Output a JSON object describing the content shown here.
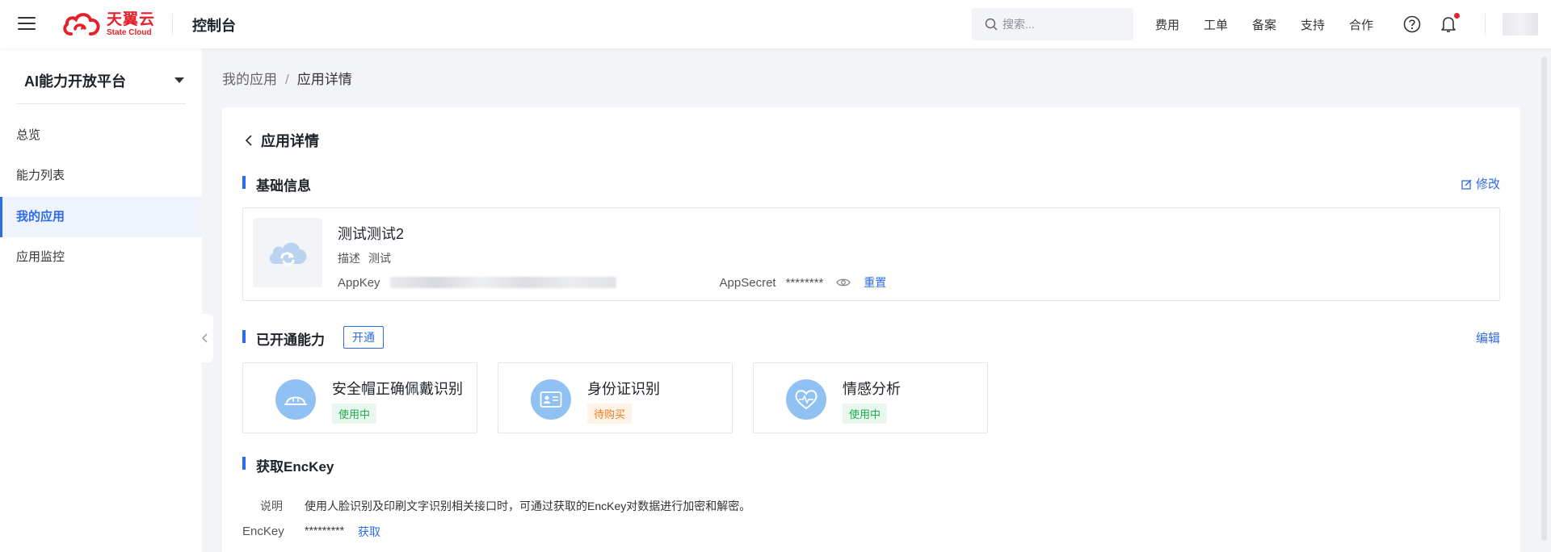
{
  "header": {
    "logo_cn": "天翼云",
    "logo_en": "State Cloud",
    "console_title": "控制台",
    "search_placeholder": "搜索...",
    "nav": [
      "费用",
      "工单",
      "备案",
      "支持",
      "合作"
    ],
    "brand_color": "#e5202b",
    "accent_color": "#2e6be6"
  },
  "sidebar": {
    "platform_title": "AI能力开放平台",
    "items": [
      {
        "label": "总览"
      },
      {
        "label": "能力列表"
      },
      {
        "label": "我的应用"
      },
      {
        "label": "应用监控"
      }
    ],
    "active_index": 2
  },
  "breadcrumb": {
    "parent": "我的应用",
    "separator": "/",
    "current": "应用详情"
  },
  "page": {
    "title": "应用详情"
  },
  "basic_info": {
    "title": "基础信息",
    "edit_label": "修改",
    "app_name": "测试测试2",
    "desc_label": "描述",
    "desc_value": "测试",
    "appkey_label": "AppKey",
    "appsecret_label": "AppSecret",
    "appsecret_value": "********",
    "reset_label": "重置"
  },
  "capabilities": {
    "title": "已开通能力",
    "open_label": "开通",
    "edit_label": "编辑",
    "items": [
      {
        "name": "安全帽正确佩戴识别",
        "status": "使用中",
        "icon": "helmet-icon"
      },
      {
        "name": "身份证识别",
        "status": "待购买",
        "icon": "id-card-icon"
      },
      {
        "name": "情感分析",
        "status": "使用中",
        "icon": "heart-pulse-icon"
      }
    ]
  },
  "enckey": {
    "title": "获取EncKey",
    "note_label": "说明",
    "note_text": "使用人脸识别及印刷文字识别相关接口时，可通过获取的EncKey对数据进行加密和解密。",
    "key_label": "EncKey",
    "key_value": "*********",
    "fetch_label": "获取"
  }
}
